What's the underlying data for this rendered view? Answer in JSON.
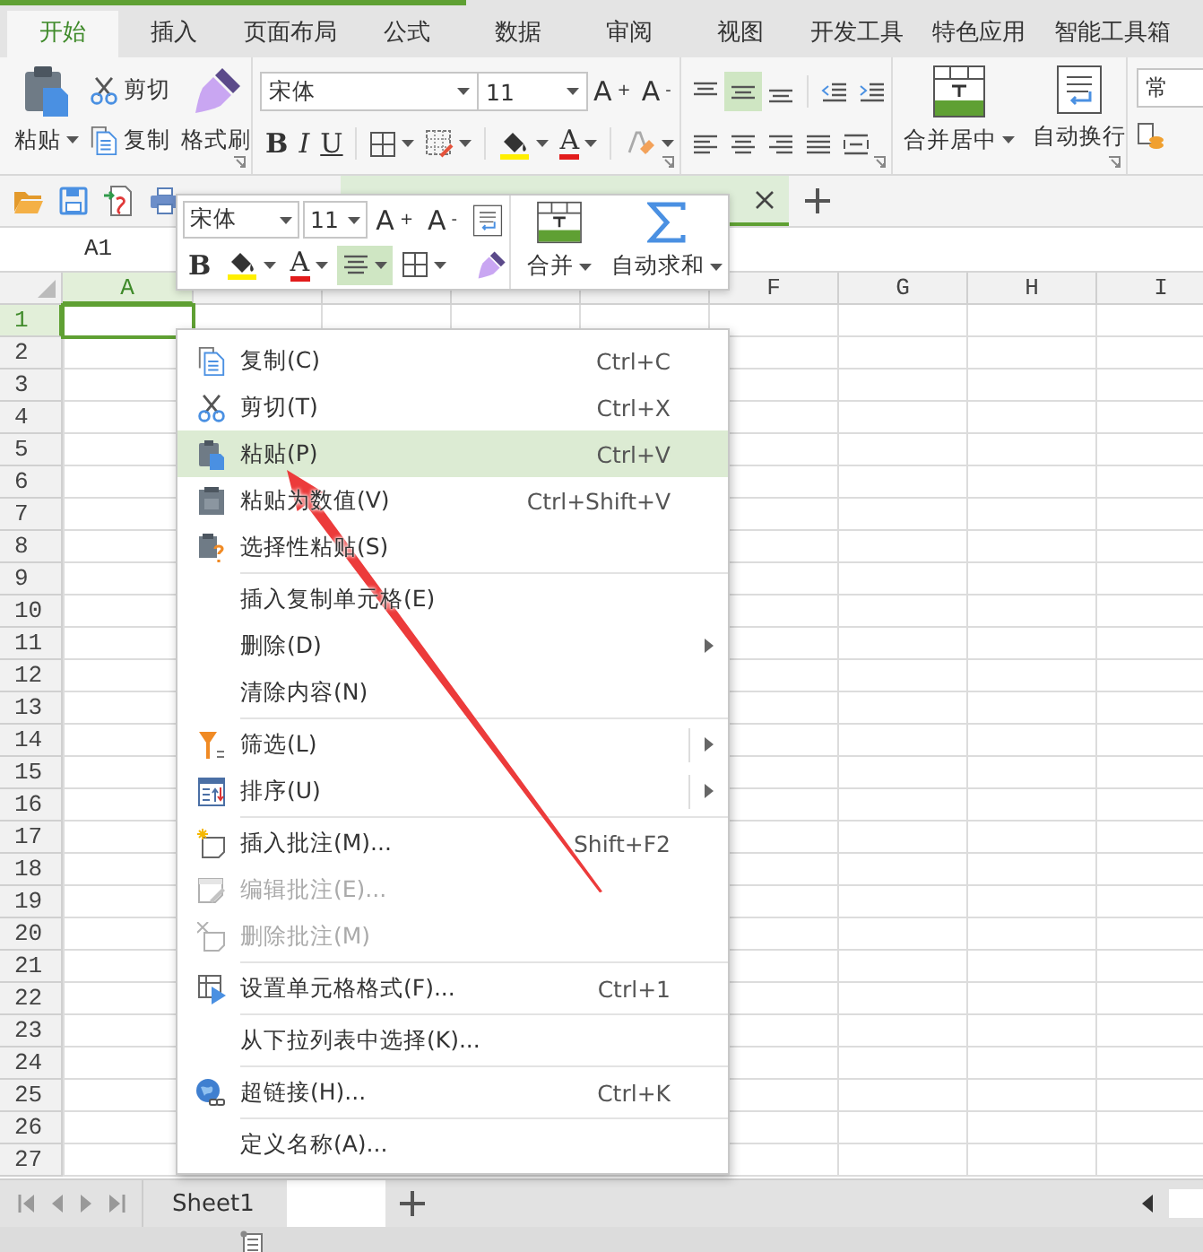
{
  "ribbon_tabs": [
    {
      "label": "开始",
      "selected": true
    },
    {
      "label": "插入",
      "selected": false
    },
    {
      "label": "页面布局",
      "selected": false
    },
    {
      "label": "公式",
      "selected": false
    },
    {
      "label": "数据",
      "selected": false
    },
    {
      "label": "审阅",
      "selected": false
    },
    {
      "label": "视图",
      "selected": false
    },
    {
      "label": "开发工具",
      "selected": false
    },
    {
      "label": "特色应用",
      "selected": false
    },
    {
      "label": "智能工具箱",
      "selected": false
    }
  ],
  "clipboard": {
    "paste": "粘贴",
    "cut": "剪切",
    "copy": "复制",
    "format_painter": "格式刷"
  },
  "font": {
    "name": "宋体",
    "size": "11",
    "grow": "A$^{+}$",
    "shrink": "A$^{-}$",
    "bold": "B",
    "italic": "I",
    "underline": "U",
    "font_color": "A"
  },
  "vertical_align": [
    {
      "selected": false
    },
    {
      "selected": true
    },
    {
      "selected": false
    }
  ],
  "merge_center": "合并居中",
  "wrap_text": "自动换行",
  "number_format": "常",
  "name_box": "A1",
  "mini_toolbar": {
    "font": "宋体",
    "size": "11",
    "grow": "A$^{+}$",
    "shrink": "A$^{-}$",
    "bold": "B",
    "font_color": "A",
    "align_selected": true,
    "merge": "合并",
    "autosum": "自动求和"
  },
  "columns": [
    {
      "label": "A",
      "selected": true
    },
    {
      "selected": false
    },
    {
      "selected": false
    },
    {
      "selected": false
    },
    {
      "selected": false
    },
    {
      "label": "F",
      "selected": false
    },
    {
      "label": "G",
      "selected": false
    },
    {
      "label": "H",
      "selected": false
    },
    {
      "label": "I",
      "selected": false
    }
  ],
  "rows": [
    {
      "label": "1",
      "selected": true
    },
    {
      "label": "2",
      "selected": false
    },
    {
      "label": "3",
      "selected": false
    },
    {
      "label": "4",
      "selected": false
    },
    {
      "label": "5",
      "selected": false
    },
    {
      "label": "6",
      "selected": false
    },
    {
      "label": "7",
      "selected": false
    },
    {
      "label": "8",
      "selected": false
    },
    {
      "label": "9",
      "selected": false
    },
    {
      "label": "10",
      "selected": false
    },
    {
      "label": "11",
      "selected": false
    },
    {
      "label": "12",
      "selected": false
    },
    {
      "label": "13",
      "selected": false
    },
    {
      "label": "14",
      "selected": false
    },
    {
      "label": "15",
      "selected": false
    },
    {
      "label": "16",
      "selected": false
    },
    {
      "label": "17",
      "selected": false
    },
    {
      "label": "18",
      "selected": false
    },
    {
      "label": "19",
      "selected": false
    },
    {
      "label": "20",
      "selected": false
    },
    {
      "label": "21",
      "selected": false
    },
    {
      "label": "22",
      "selected": false
    },
    {
      "label": "23",
      "selected": false
    },
    {
      "label": "24",
      "selected": false
    },
    {
      "label": "25",
      "selected": false
    },
    {
      "label": "26",
      "selected": false
    },
    {
      "label": "27",
      "selected": false
    }
  ],
  "context_menu": [
    {
      "kind": "item",
      "label": "复制(C)",
      "shortcut": "Ctrl+C",
      "selected": false,
      "disabled": false
    },
    {
      "kind": "item",
      "label": "剪切(T)",
      "shortcut": "Ctrl+X",
      "selected": false,
      "disabled": false
    },
    {
      "kind": "item",
      "label": "粘贴(P)",
      "shortcut": "Ctrl+V",
      "selected": true,
      "disabled": false
    },
    {
      "kind": "item",
      "label": "粘贴为数值(V)",
      "shortcut": "Ctrl+Shift+V",
      "selected": false,
      "disabled": false
    },
    {
      "kind": "item",
      "label": "选择性粘贴(S)",
      "selected": false,
      "disabled": false
    },
    {
      "kind": "separator"
    },
    {
      "kind": "item",
      "label": "插入复制单元格(E)",
      "selected": false,
      "disabled": false
    },
    {
      "kind": "item",
      "label": "删除(D)",
      "selected": false,
      "disabled": false,
      "submenu": true
    },
    {
      "kind": "item",
      "label": "清除内容(N)",
      "selected": false,
      "disabled": false
    },
    {
      "kind": "separator"
    },
    {
      "kind": "item",
      "label": "筛选(L)",
      "selected": false,
      "disabled": false,
      "submenu": true,
      "split": true
    },
    {
      "kind": "item",
      "label": "排序(U)",
      "selected": false,
      "disabled": false,
      "submenu": true,
      "split": true
    },
    {
      "kind": "separator"
    },
    {
      "kind": "item",
      "label": "插入批注(M)...",
      "shortcut": "Shift+F2",
      "selected": false,
      "disabled": false
    },
    {
      "kind": "item",
      "label": "编辑批注(E)...",
      "selected": false,
      "disabled": true
    },
    {
      "kind": "item",
      "label": "删除批注(M)",
      "selected": false,
      "disabled": true
    },
    {
      "kind": "separator"
    },
    {
      "kind": "item",
      "label": "设置单元格格式(F)...",
      "shortcut": "Ctrl+1",
      "selected": false,
      "disabled": false
    },
    {
      "kind": "separator"
    },
    {
      "kind": "item",
      "label": "从下拉列表中选择(K)...",
      "selected": false,
      "disabled": false
    },
    {
      "kind": "separator"
    },
    {
      "kind": "item",
      "label": "超链接(H)...",
      "shortcut": "Ctrl+K",
      "selected": false,
      "disabled": false
    },
    {
      "kind": "separator"
    },
    {
      "kind": "item",
      "label": "定义名称(A)...",
      "selected": false,
      "disabled": false
    }
  ],
  "sheet_tabs": [
    {
      "label": "Sheet1",
      "selected": false
    },
    {
      "selected": true
    }
  ]
}
